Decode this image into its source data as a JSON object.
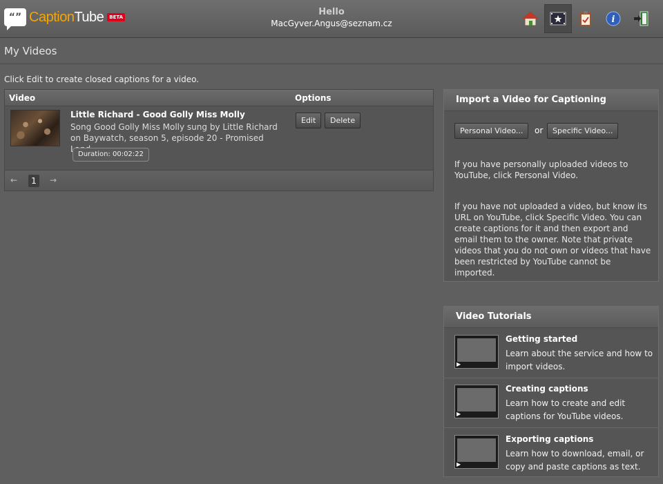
{
  "header": {
    "logo": {
      "glyph": "“”",
      "part1": "Caption",
      "part2": "Tube",
      "badge": "BETA"
    },
    "greeting": "Hello",
    "user_email": "MacGyver.Angus@seznam.cz",
    "nav": [
      "home-icon",
      "my-videos-icon",
      "tasks-icon",
      "info-icon",
      "logout-icon"
    ]
  },
  "page": {
    "title": "My Videos",
    "instruction": "Click Edit to create closed captions for a video."
  },
  "video_table": {
    "columns": [
      "Video",
      "Options"
    ],
    "rows": [
      {
        "title": "Little Richard - Good Golly Miss Molly",
        "description": "Song Good Golly Miss Molly sung by Little Richard on Baywatch, season 5, episode 20 - Promised Land.",
        "duration": "Duration: 00:02:22",
        "edit_label": "Edit",
        "delete_label": "Delete"
      }
    ],
    "pagination": {
      "prev": "←",
      "page": "1",
      "next": "→"
    }
  },
  "import_panel": {
    "title": "Import a Video for Captioning",
    "personal_button": "Personal Video...",
    "or": "or",
    "specific_button": "Specific Video...",
    "text1": "If you have personally uploaded videos to YouTube, click Personal Video.",
    "text2": "If you have not uploaded a video, but know its URL on YouTube, click Specific Video. You can create captions for it and then export and email them to the owner. Note that private videos that you do not own or videos that have been restricted by YouTube cannot be imported."
  },
  "tutorials": {
    "title": "Video Tutorials",
    "items": [
      {
        "title": "Getting started",
        "description": "Learn about the service and how to import videos."
      },
      {
        "title": "Creating captions",
        "description": "Learn how to create and edit captions for YouTube videos."
      },
      {
        "title": "Exporting captions",
        "description": "Learn how to download, email, or copy and paste captions as text."
      }
    ]
  }
}
